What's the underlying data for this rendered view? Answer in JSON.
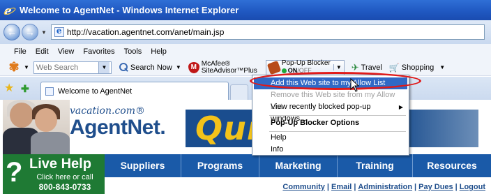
{
  "window": {
    "title": "Welcome to AgentNet - Windows Internet Explorer"
  },
  "address": {
    "url": "http://vacation.agentnet.com/anet/main.jsp"
  },
  "menubar": {
    "items": [
      "File",
      "Edit",
      "View",
      "Favorites",
      "Tools",
      "Help"
    ]
  },
  "toolbar": {
    "search_placeholder": "Web Search",
    "search_now": "Search Now",
    "mcafee_line1": "McAfee®",
    "mcafee_line2": "SiteAdvisor™Plus",
    "popup_line1": "Pop-Up Blocker",
    "popup_on": "ON",
    "popup_off": "/OFF",
    "travel": "Travel",
    "shopping": "Shopping"
  },
  "tab": {
    "title": "Welcome to AgentNet"
  },
  "dropdown": {
    "items": [
      "Add this Web site to my Allow List",
      "Remove this Web site from my Allow List",
      "View recently blocked pop-up windows...",
      "Pop-Up Blocker Options",
      "Help",
      "Info"
    ]
  },
  "site": {
    "brand_small": "vacation.com®",
    "brand_big": "AgentNet.",
    "banner_text": "Quic",
    "live_help": "Live Help",
    "live_help_sub": "Click here or call",
    "live_help_phone": "800-843-0733",
    "nav": [
      "Suppliers",
      "Programs",
      "Marketing",
      "Training",
      "Resources"
    ],
    "util_links": [
      "Community",
      "Email",
      "Administration",
      "Pay Dues",
      "Logout"
    ]
  },
  "colors": {
    "title_bar": "#1f57c0",
    "nav_bar": "#1a5aa8",
    "live_help": "#1f7a34",
    "menu_highlight": "#3169c6",
    "callout_oval": "#e01a1a",
    "banner_text": "#f3c21a"
  }
}
